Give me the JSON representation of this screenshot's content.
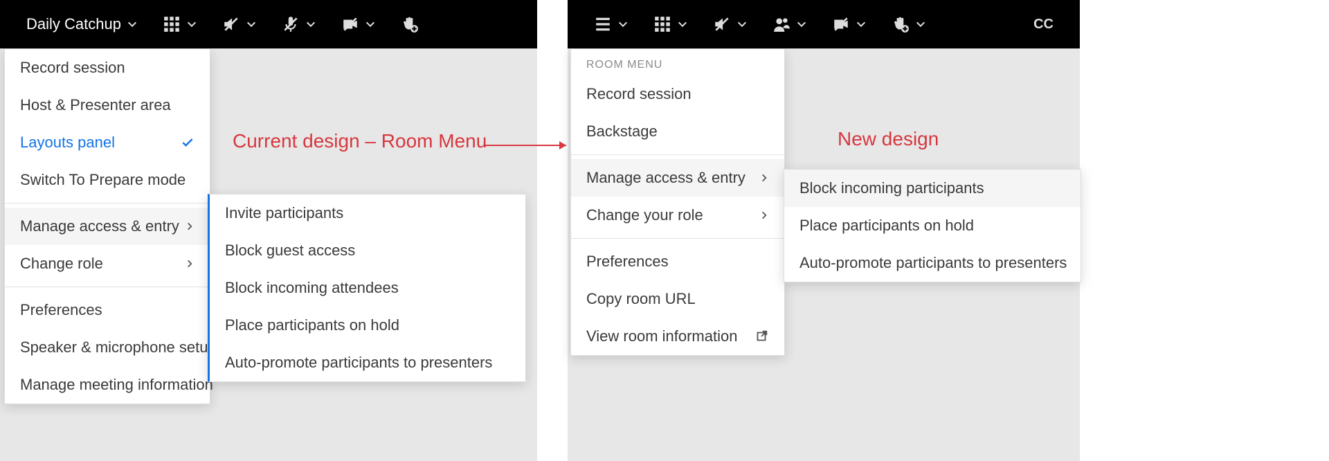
{
  "annotations": {
    "current_label": "Current design – Room Menu",
    "new_label": "New design"
  },
  "left": {
    "room_name": "Daily Catchup",
    "menu": {
      "record": "Record session",
      "host_area": "Host & Presenter area",
      "layouts": "Layouts panel",
      "prepare": "Switch To Prepare mode",
      "manage_access": "Manage access & entry",
      "change_role": "Change role",
      "preferences": "Preferences",
      "speaker_mic": "Speaker & microphone setup",
      "meeting_info": "Manage meeting information"
    },
    "submenu": {
      "invite": "Invite participants",
      "block_guest": "Block guest access",
      "block_incoming": "Block incoming attendees",
      "place_hold": "Place participants on hold",
      "auto_promote": "Auto-promote participants to presenters"
    }
  },
  "right": {
    "cc_label": "CC",
    "menu_header": "ROOM MENU",
    "menu": {
      "record": "Record session",
      "backstage": "Backstage",
      "manage_access": "Manage access & entry",
      "change_role": "Change your role",
      "preferences": "Preferences",
      "copy_url": "Copy room URL",
      "view_info": "View room information"
    },
    "submenu": {
      "block_incoming": "Block incoming participants",
      "place_hold": "Place participants on hold",
      "auto_promote": "Auto-promote participants to presenters"
    }
  }
}
